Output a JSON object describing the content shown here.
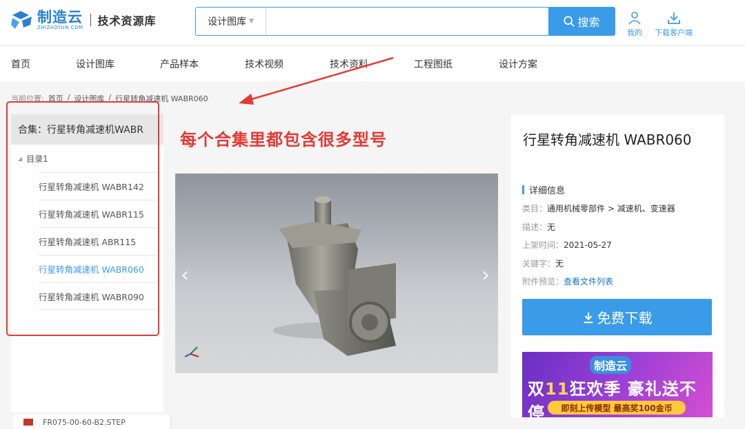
{
  "header": {
    "logo_cn": "制造云",
    "logo_en": "ZHIZAOYUN.COM",
    "logo_sub": "技术资源库",
    "search_category": "设计图库",
    "search_placeholder": "",
    "search_button": "搜索",
    "my_label": "我的",
    "download_client_label": "下载客户端"
  },
  "nav": {
    "items": [
      "首页",
      "设计图库",
      "产品样本",
      "技术视频",
      "技术资料",
      "工程图纸",
      "设计方案"
    ]
  },
  "breadcrumb": {
    "prefix": "当前位置:",
    "items": [
      "首页",
      "/",
      "设计图库",
      "/",
      "行星转角减速机 WABR060"
    ]
  },
  "sidebar": {
    "collection": "合集：行星转角减速机WABR",
    "directory": "目录1",
    "items": [
      {
        "label": "行星转角减速机 WABR142",
        "active": false
      },
      {
        "label": "行星转角减速机 WABR115",
        "active": false
      },
      {
        "label": "行星转角减速机 ABR115",
        "active": false
      },
      {
        "label": "行星转角减速机 WABR060",
        "active": true
      },
      {
        "label": "行星转角减速机 WABR090",
        "active": false
      }
    ]
  },
  "annotation": "每个合集里都包含很多型号",
  "preview": {
    "prev": "‹",
    "next": "›"
  },
  "detail": {
    "title": "行星转角减速机 WABR060",
    "section": "详细信息",
    "category_label": "类目：",
    "category_value": "通用机械零部件 > 减速机、变速器",
    "desc_label": "描述：",
    "desc_value": "无",
    "date_label": "上架时间：",
    "date_value": "2021-05-27",
    "keyword_label": "关键字：",
    "keyword_value": "无",
    "attach_label": "附件预览：",
    "attach_value": "查看文件列表",
    "download_button": "免费下载"
  },
  "promo": {
    "logo": "制造云",
    "main_a": "双",
    "main_hl": "11",
    "main_b": "狂欢季 豪礼送不停",
    "sub": "即刻上传模型 最高奖100金币"
  },
  "bottom_file": "FR075-00-60-B2.STEP",
  "colors": {
    "accent": "#3a9be8",
    "annotation": "#e53935",
    "active_link": "#3a9be8"
  }
}
